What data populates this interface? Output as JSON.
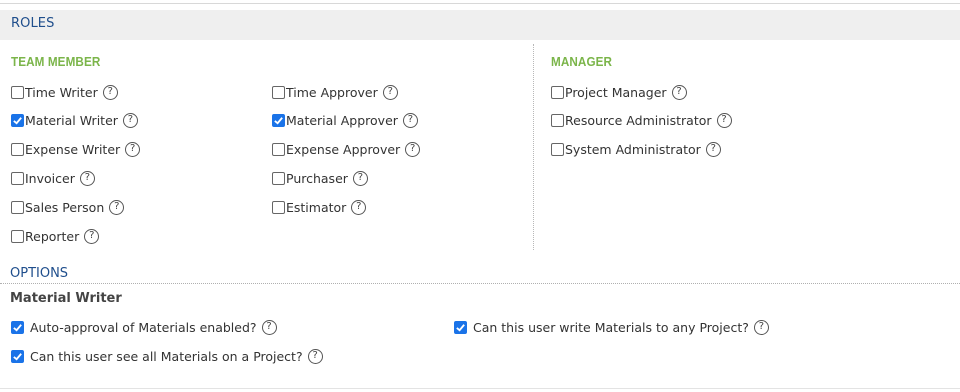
{
  "roles_header": "ROLES",
  "team_member": {
    "title": "TEAM MEMBER",
    "col1": [
      {
        "label": "Time Writer",
        "checked": false
      },
      {
        "label": "Material Writer",
        "checked": true
      },
      {
        "label": "Expense Writer",
        "checked": false
      },
      {
        "label": "Invoicer",
        "checked": false
      },
      {
        "label": "Sales Person",
        "checked": false
      },
      {
        "label": "Reporter",
        "checked": false
      }
    ],
    "col2": [
      {
        "label": "Time Approver",
        "checked": false
      },
      {
        "label": "Material Approver",
        "checked": true
      },
      {
        "label": "Expense Approver",
        "checked": false
      },
      {
        "label": "Purchaser",
        "checked": false
      },
      {
        "label": "Estimator",
        "checked": false
      }
    ]
  },
  "manager": {
    "title": "MANAGER",
    "items": [
      {
        "label": "Project Manager",
        "checked": false
      },
      {
        "label": "Resource Administrator",
        "checked": false
      },
      {
        "label": "System Administrator",
        "checked": false
      }
    ]
  },
  "options": {
    "title": "OPTIONS",
    "material_writer": {
      "title": "Material Writer",
      "items": [
        {
          "label": "Auto-approval of Materials enabled?",
          "checked": true
        },
        {
          "label": "Can this user write Materials to any Project?",
          "checked": true
        },
        {
          "label": "Can this user see all Materials on a Project?",
          "checked": true
        }
      ]
    }
  },
  "icons": {
    "help": "help-circle-icon",
    "check": "checkmark-icon"
  },
  "colors": {
    "header_bg": "#efefef",
    "header_text": "#1f4e8c",
    "section_green": "#7bb54a",
    "checkbox_checked": "#1a73e8"
  }
}
